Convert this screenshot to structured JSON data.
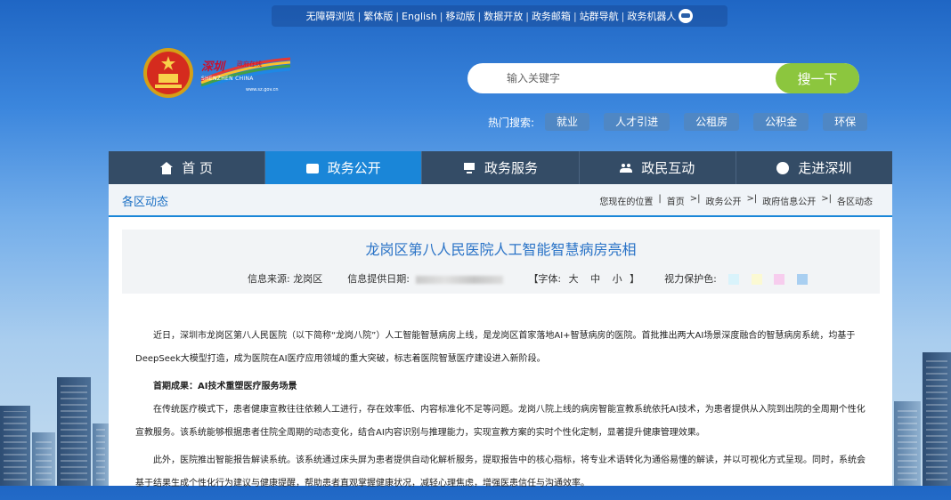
{
  "topbar": {
    "links": [
      "无障碍浏览",
      "繁体版",
      "English",
      "移动版",
      "数据开放",
      "政务邮箱",
      "站群导航",
      "政务机器人"
    ]
  },
  "brand": {
    "cn": "深圳",
    "sub": "政府在线",
    "en": "SHENZHEN CHINA",
    "url": "www.sz.gov.cn"
  },
  "search": {
    "placeholder": "输入关键字",
    "button": "搜一下"
  },
  "hot_search": {
    "label": "热门搜索:",
    "tags": [
      "就业",
      "人才引进",
      "公租房",
      "公积金",
      "环保"
    ]
  },
  "nav": [
    {
      "label": "首 页",
      "icon": "home-icon"
    },
    {
      "label": "政务公开",
      "icon": "news-icon",
      "active": true
    },
    {
      "label": "政务服务",
      "icon": "monitor-icon"
    },
    {
      "label": "政民互动",
      "icon": "people-icon"
    },
    {
      "label": "走进深圳",
      "icon": "chat-icon"
    }
  ],
  "section_title": "各区动态",
  "breadcrumb": {
    "label": "您现在的位置",
    "items": [
      "首页",
      "政务公开",
      "政府信息公开",
      "各区动态"
    ]
  },
  "article": {
    "title": "龙岗区第八人民医院人工智能智慧病房亮相",
    "source_label": "信息来源:",
    "source": "龙岗区",
    "date_label": "信息提供日期:",
    "font_label": "【字体:",
    "font_sizes": [
      "大",
      "中",
      "小"
    ],
    "font_close": "】",
    "eye_label": "视力保护色:",
    "eye_colors": [
      "#d9f3fb",
      "#fbf9d3",
      "#f7cdee",
      "#a9cff1"
    ],
    "paragraphs": [
      "近日，深圳市龙岗区第八人民医院（以下简称“龙岗八院”）人工智能智慧病房上线，是龙岗区首家落地AI+智慧病房的医院。首批推出两大AI场景深度融合的智慧病房系统，均基于DeepSeek大模型打造，成为医院在AI医疗应用领域的重大突破，标志着医院智慧医疗建设进入新阶段。",
      "首期成果：AI技术重塑医疗服务场景",
      "在传统医疗模式下，患者健康宣教往往依赖人工进行，存在效率低、内容标准化不足等问题。龙岗八院上线的病房智能宣教系统依托AI技术，为患者提供从入院到出院的全周期个性化宣教服务。该系统能够根据患者住院全周期的动态变化，结合AI内容识别与推理能力，实现宣教方案的实时个性化定制，显著提升健康管理效果。",
      "此外，医院推出智能报告解读系统。该系统通过床头屏为患者提供自动化解析服务，提取报告中的核心指标，将专业术语转化为通俗易懂的解读，并以可视化方式呈现。同时，系统会基于结果生成个性化行为建议与健康提醒，帮助患者直观掌握健康状况，减轻心理焦虑，增强医患信任与沟通效率。"
    ]
  }
}
